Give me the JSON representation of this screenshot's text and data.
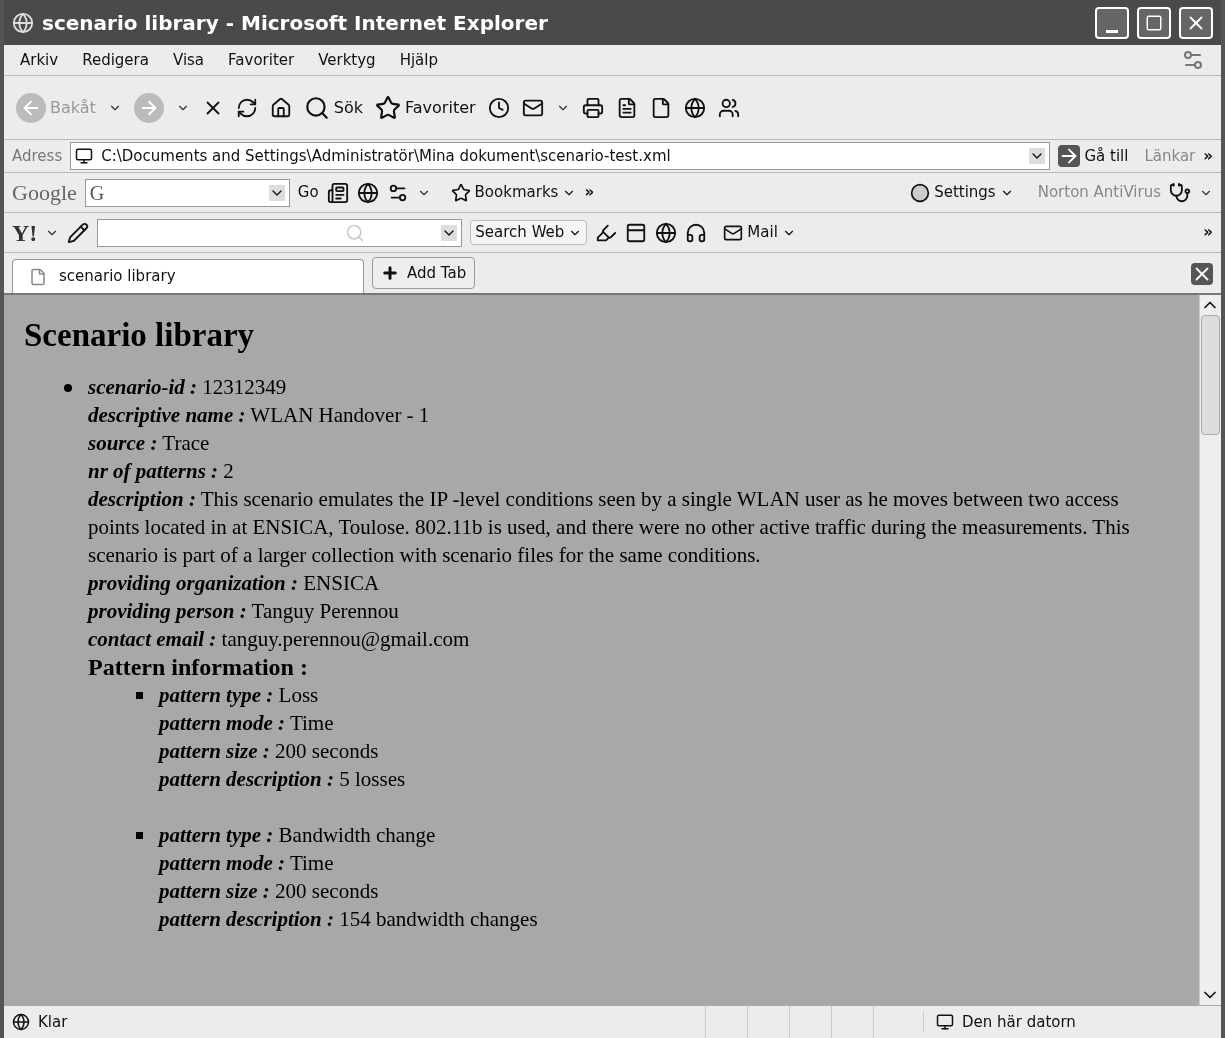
{
  "window": {
    "title": "scenario library - Microsoft Internet Explorer"
  },
  "menu": [
    "Arkiv",
    "Redigera",
    "Visa",
    "Favoriter",
    "Verktyg",
    "Hjälp"
  ],
  "toolbar": {
    "back": "Bakåt",
    "search": "Sök",
    "favorites": "Favoriter"
  },
  "address": {
    "label": "Adress",
    "value": "C:\\Documents and Settings\\Administratör\\Mina dokument\\scenario-test.xml",
    "go": "Gå till",
    "links": "Länkar",
    "more": "»"
  },
  "google_bar": {
    "logo": "Google",
    "g": "G",
    "go": "Go",
    "bookmarks": "Bookmarks",
    "more": "»",
    "settings": "Settings",
    "norton": "Norton AntiVirus"
  },
  "yahoo_bar": {
    "logo": "Y!",
    "search_button": "Search Web",
    "mail": "Mail",
    "more": "»"
  },
  "tabs": [
    {
      "label": "scenario library",
      "selected": true
    }
  ],
  "add_tab": "Add Tab",
  "page": {
    "heading": "Scenario library",
    "scenarios": [
      {
        "fields": [
          {
            "label": "scenario-id :",
            "value": "12312349"
          },
          {
            "label": "descriptive name :",
            "value": "WLAN Handover - 1"
          },
          {
            "label": "source :",
            "value": "Trace"
          },
          {
            "label": "nr of patterns :",
            "value": "2"
          },
          {
            "label": "description :",
            "value": "This scenario emulates the IP -level conditions seen by a single WLAN user as he moves between two access points located in at ENSICA, Toulose. 802.11b is used, and there were no other active traffic during the measurements. This scenario is part of a larger collection with scenario files for the same conditions."
          },
          {
            "label": "providing organization :",
            "value": "ENSICA"
          },
          {
            "label": "providing person :",
            "value": "Tanguy Perennou"
          },
          {
            "label": "contact email :",
            "value": "tanguy.perennou@gmail.com"
          }
        ],
        "pattern_heading": "Pattern information :",
        "patterns": [
          {
            "fields": [
              {
                "label": "pattern type :",
                "value": "Loss"
              },
              {
                "label": "pattern mode :",
                "value": "Time"
              },
              {
                "label": "pattern size :",
                "value": "200 seconds"
              },
              {
                "label": "pattern description :",
                "value": "5 losses"
              }
            ]
          },
          {
            "fields": [
              {
                "label": "pattern type :",
                "value": "Bandwidth change"
              },
              {
                "label": "pattern mode :",
                "value": "Time"
              },
              {
                "label": "pattern size :",
                "value": "200 seconds"
              },
              {
                "label": "pattern description :",
                "value": "154 bandwidth changes"
              }
            ]
          }
        ]
      }
    ]
  },
  "status_bar": {
    "text": "Klar",
    "zone": "Den här datorn"
  }
}
